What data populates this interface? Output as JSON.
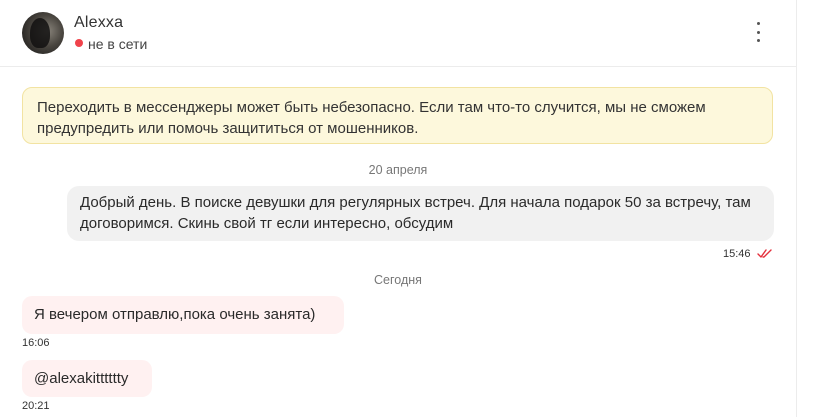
{
  "contact": {
    "name": "Alexxa",
    "status": "не в сети",
    "status_color": "#f0434b"
  },
  "menu_icon": "more-vertical-icon",
  "warning": {
    "text": "Переходить в мессенджеры может быть небезопасно. Если там что-то случится, мы не сможем предупредить или помочь защититься от мошенников."
  },
  "messages": [
    {
      "date_label": "20 апреля",
      "direction": "outgoing",
      "text": "Добрый день. В поиске девушки для регулярных встреч. Для начала подарок 50 за встречу, там договоримся. Скинь свой тг если интересно, обсудим",
      "time": "15:46",
      "read_icon": "double-check-icon",
      "read_color": "#e4303c"
    }
  ],
  "today": {
    "date_label": "Сегодня",
    "incoming": [
      {
        "text": "Я вечером отправлю,пока очень занята)",
        "time": "16:06"
      },
      {
        "text": "@alexakitttttty",
        "time": "20:21"
      }
    ]
  }
}
